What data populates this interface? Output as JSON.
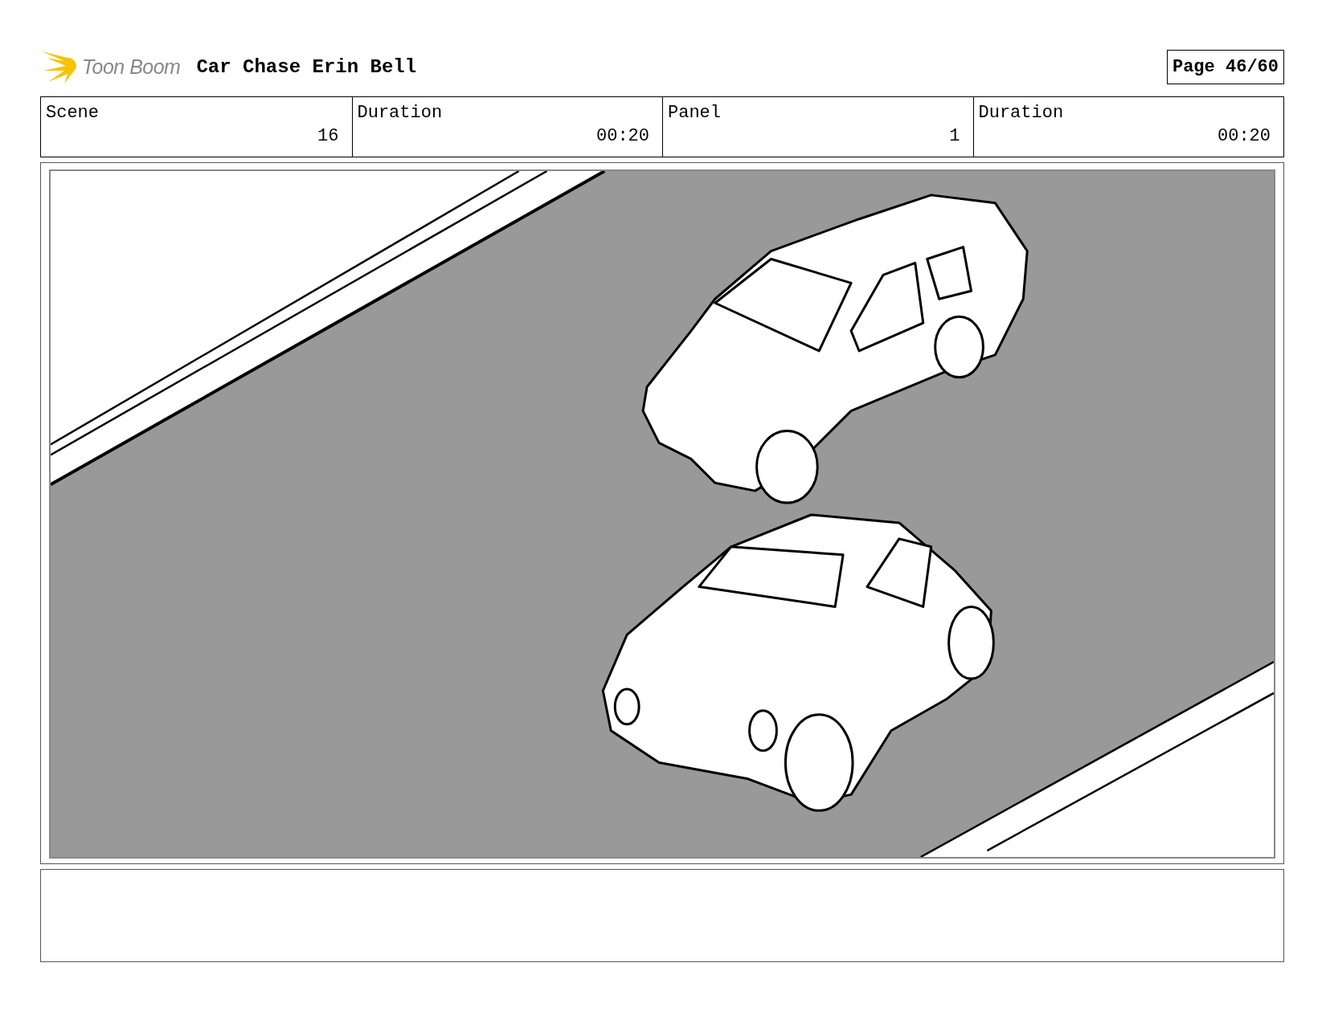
{
  "header": {
    "brand": "Toon Boom",
    "title": "Car Chase Erin Bell",
    "page": "Page 46/60"
  },
  "info": [
    {
      "label": "Scene",
      "value": "16"
    },
    {
      "label": "Duration",
      "value": "00:20"
    },
    {
      "label": "Panel",
      "value": "1"
    },
    {
      "label": "Duration",
      "value": "00:20"
    }
  ]
}
